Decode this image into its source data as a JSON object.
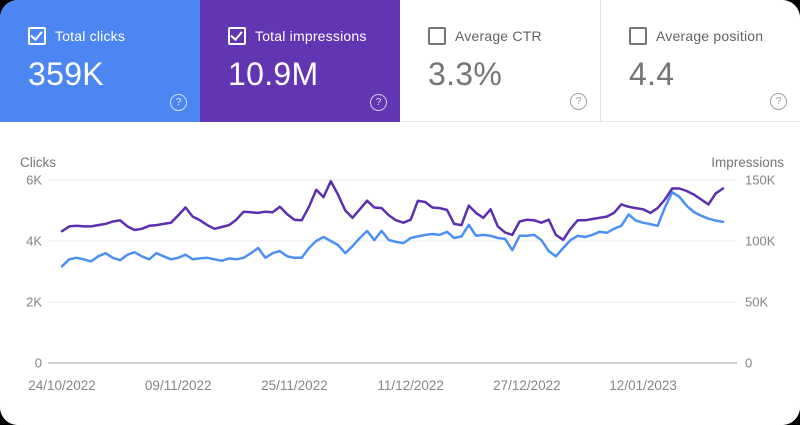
{
  "help_glyph": "?",
  "cards": [
    {
      "label": "Total clicks",
      "value": "359K",
      "checked": true,
      "bg_color": "#4c86f3"
    },
    {
      "label": "Total impressions",
      "value": "10.9M",
      "checked": true,
      "bg_color": "#6236b2"
    },
    {
      "label": "Average CTR",
      "value": "3.3%",
      "checked": false,
      "bg_color": "#ffffff"
    },
    {
      "label": "Average position",
      "value": "4.4",
      "checked": false,
      "bg_color": "#ffffff"
    }
  ],
  "chart_data": {
    "type": "line",
    "grid": "horizontal",
    "x_tick_labels": [
      "24/10/2022",
      "09/11/2022",
      "25/11/2022",
      "11/12/2022",
      "27/12/2022",
      "12/01/2023"
    ],
    "x_label_interval_days": 16,
    "left_axis": {
      "title": "Clicks",
      "ticks": [
        "0",
        "2K",
        "4K",
        "6K"
      ],
      "min": 0,
      "max": 6000
    },
    "right_axis": {
      "title": "Impressions",
      "ticks": [
        "0",
        "50K",
        "100K",
        "150K"
      ],
      "min": 0,
      "max": 150000
    },
    "series": [
      {
        "name": "Total clicks",
        "axis": "left",
        "color": "#4d90f5",
        "values": [
          3170,
          3400,
          3450,
          3400,
          3330,
          3500,
          3600,
          3450,
          3370,
          3550,
          3630,
          3500,
          3400,
          3600,
          3500,
          3400,
          3450,
          3550,
          3400,
          3430,
          3450,
          3400,
          3350,
          3430,
          3400,
          3450,
          3600,
          3770,
          3450,
          3600,
          3670,
          3500,
          3450,
          3450,
          3770,
          4000,
          4130,
          4000,
          3870,
          3600,
          3830,
          4100,
          4330,
          4030,
          4330,
          4030,
          3970,
          3930,
          4100,
          4150,
          4200,
          4230,
          4200,
          4300,
          4100,
          4150,
          4530,
          4170,
          4200,
          4170,
          4100,
          4070,
          3700,
          4170,
          4170,
          4200,
          4030,
          3670,
          3500,
          3770,
          4030,
          4170,
          4130,
          4200,
          4300,
          4270,
          4400,
          4500,
          4870,
          4670,
          4600,
          4550,
          4500,
          5100,
          5600,
          5450,
          5150,
          4950,
          4830,
          4730,
          4670,
          4630
        ]
      },
      {
        "name": "Total impressions",
        "axis": "right",
        "color": "#5c2fb0",
        "values": [
          108000,
          112000,
          112500,
          112000,
          112000,
          113000,
          114000,
          116000,
          117000,
          112000,
          109000,
          110000,
          112500,
          113000,
          114000,
          115000,
          121000,
          127500,
          120000,
          117000,
          113000,
          110000,
          111500,
          113000,
          117500,
          124000,
          123500,
          123000,
          124000,
          123500,
          128000,
          122000,
          117500,
          117000,
          128000,
          142000,
          136000,
          149000,
          138000,
          125000,
          119000,
          126000,
          133000,
          127500,
          127000,
          121000,
          117000,
          115000,
          117500,
          133000,
          132000,
          127500,
          127000,
          125500,
          114000,
          113000,
          129000,
          123000,
          119000,
          126000,
          112000,
          107000,
          105000,
          116000,
          117500,
          117000,
          115000,
          117500,
          105000,
          101000,
          110000,
          117000,
          117000,
          118000,
          119000,
          120000,
          123000,
          130000,
          128000,
          127000,
          126000,
          123000,
          127000,
          134000,
          143000,
          143000,
          141000,
          138000,
          134000,
          130000,
          139000,
          143000
        ]
      }
    ]
  }
}
